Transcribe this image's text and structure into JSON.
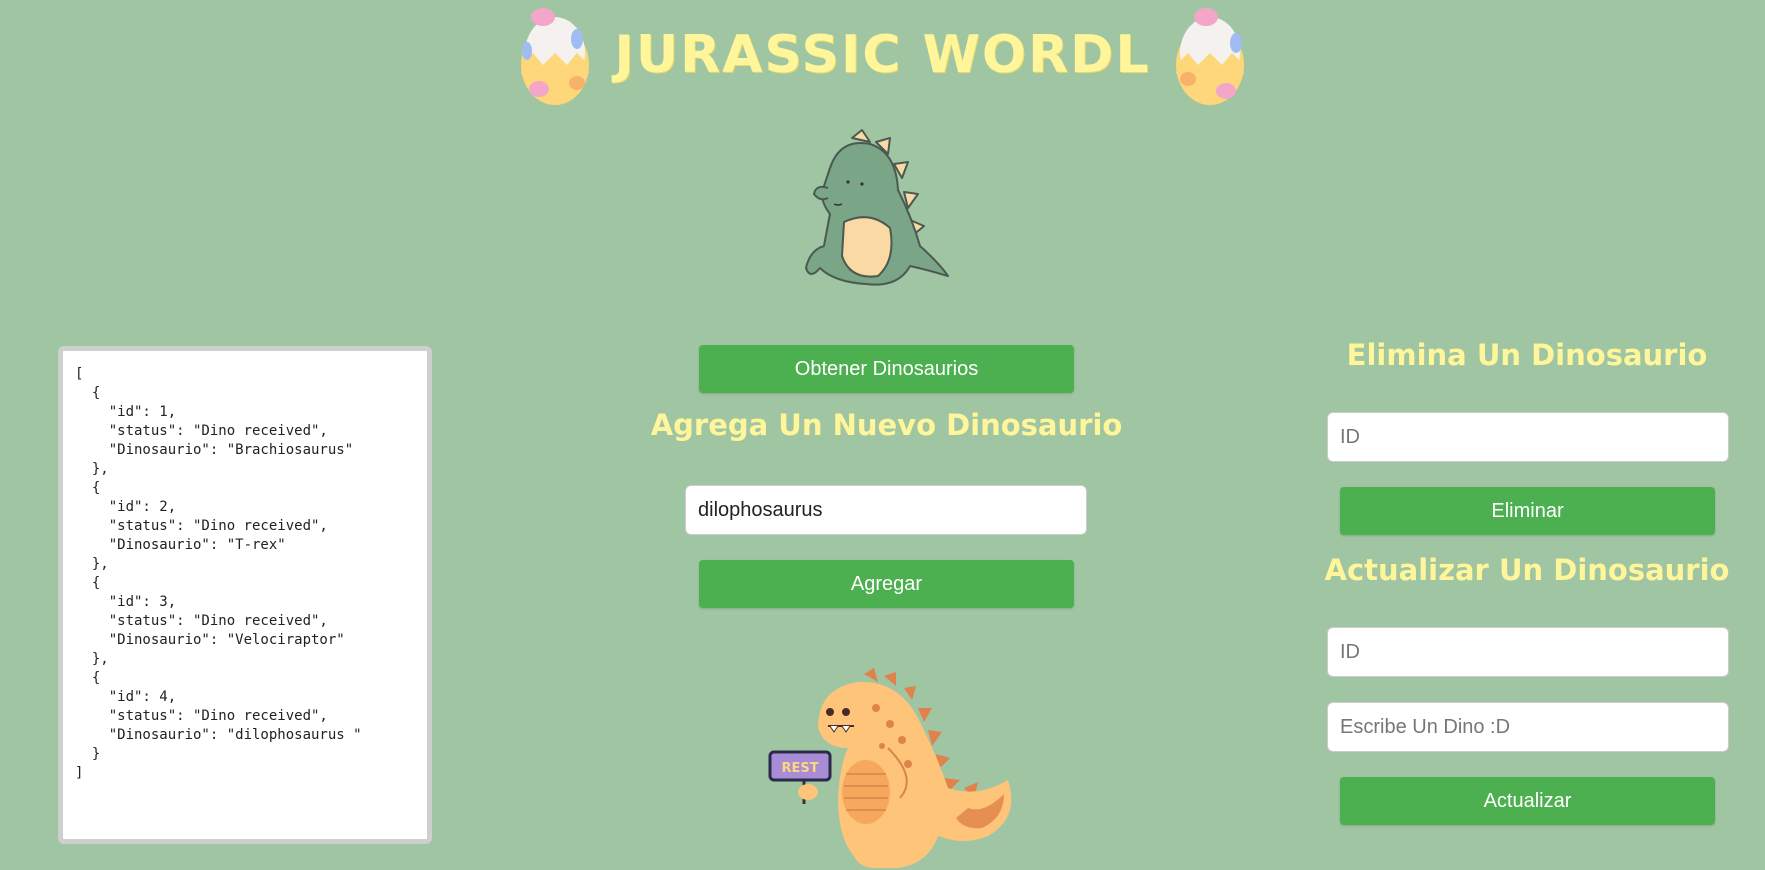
{
  "header": {
    "title": "Jurassic Wordl"
  },
  "response_json": "[\n  {\n    \"id\": 1,\n    \"status\": \"Dino received\",\n    \"Dinosaurio\": \"Brachiosaurus\"\n  },\n  {\n    \"id\": 2,\n    \"status\": \"Dino received\",\n    \"Dinosaurio\": \"T-rex\"\n  },\n  {\n    \"id\": 3,\n    \"status\": \"Dino received\",\n    \"Dinosaurio\": \"Velociraptor\"\n  },\n  {\n    \"id\": 4,\n    \"status\": \"Dino received\",\n    \"Dinosaurio\": \"dilophosaurus \"\n  }\n]",
  "center": {
    "get_button": "Obtener Dinosaurios",
    "add_title": "Agrega Un Nuevo Dinosaurio",
    "add_input_value": "dilophosaurus",
    "add_button": "Agregar",
    "sign_text": "REST"
  },
  "right": {
    "delete_title": "Elimina Un Dinosaurio",
    "delete_id_placeholder": "ID",
    "delete_button": "Eliminar",
    "update_title": "Actualizar Un Dinosaurio",
    "update_id_placeholder": "ID",
    "update_name_placeholder": "Escribe Un Dino :D",
    "update_button": "Actualizar"
  },
  "colors": {
    "background": "#9fc5a3",
    "accent_text": "#fff59a",
    "button": "#4caf50"
  }
}
